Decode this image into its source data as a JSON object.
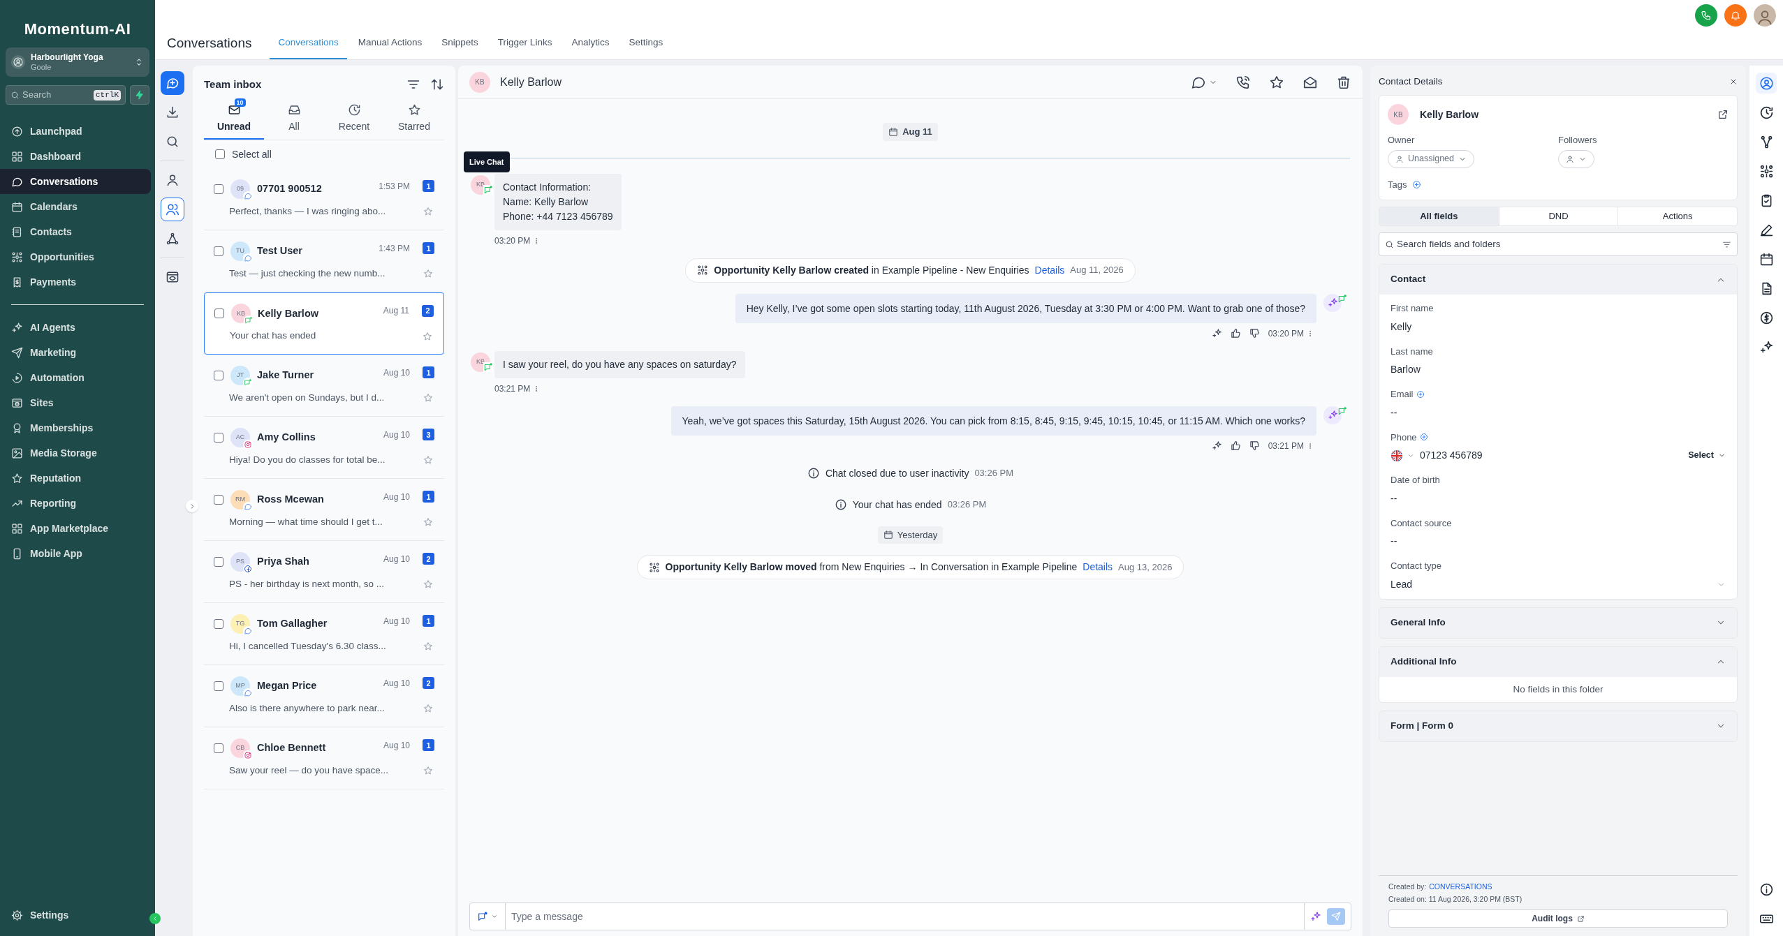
{
  "sidebar": {
    "brand": "Momentum-AI",
    "account": {
      "name": "Harbourlight Yoga",
      "location": "Goole"
    },
    "search": {
      "placeholder": "Search",
      "shortcut": "ctrlK"
    },
    "primary_items": [
      {
        "label": "Launchpad",
        "selected": false
      },
      {
        "label": "Dashboard",
        "selected": false
      },
      {
        "label": "Conversations",
        "selected": true
      },
      {
        "label": "Calendars",
        "selected": false
      },
      {
        "label": "Contacts",
        "selected": false
      },
      {
        "label": "Opportunities",
        "selected": false
      },
      {
        "label": "Payments",
        "selected": false
      }
    ],
    "secondary_items": [
      {
        "label": "AI Agents",
        "selected": false
      },
      {
        "label": "Marketing",
        "selected": false
      },
      {
        "label": "Automation",
        "selected": false
      },
      {
        "label": "Sites",
        "selected": false
      },
      {
        "label": "Memberships",
        "selected": false
      },
      {
        "label": "Media Storage",
        "selected": false
      },
      {
        "label": "Reputation",
        "selected": false
      },
      {
        "label": "Reporting",
        "selected": false
      },
      {
        "label": "App Marketplace",
        "selected": false
      },
      {
        "label": "Mobile App",
        "selected": false
      }
    ],
    "settings": "Settings"
  },
  "header": {
    "title": "Conversations",
    "tabs": [
      {
        "label": "Conversations",
        "selected": true
      },
      {
        "label": "Manual Actions",
        "selected": false
      },
      {
        "label": "Snippets",
        "selected": false
      },
      {
        "label": "Trigger Links",
        "selected": false
      },
      {
        "label": "Analytics",
        "selected": false
      },
      {
        "label": "Settings",
        "selected": false
      }
    ]
  },
  "rail": [
    {
      "kind": "compose",
      "selected": false
    },
    {
      "kind": "download",
      "selected": false
    },
    {
      "kind": "search",
      "selected": false
    },
    {
      "kind": "person",
      "selected": false
    },
    {
      "kind": "team",
      "selected": true
    },
    {
      "kind": "network",
      "selected": false
    },
    {
      "kind": "preview",
      "selected": false
    }
  ],
  "inbox": {
    "title": "Team inbox",
    "filters": [
      {
        "label": "Unread",
        "badge": "10",
        "selected": true
      },
      {
        "label": "All",
        "selected": false
      },
      {
        "label": "Recent",
        "selected": false
      },
      {
        "label": "Starred",
        "selected": false
      }
    ],
    "select_all": {
      "label": "Select all",
      "checked": false
    },
    "conversations": [
      {
        "initials": "09",
        "color": "#dfe3f7",
        "kind": "chat",
        "name": "07701 900512",
        "time": "1:53 PM",
        "count": "1",
        "preview": "Perfect, thanks — I was ringing abo...",
        "checked": false,
        "selected": false
      },
      {
        "initials": "TU",
        "color": "#cde8fa",
        "kind": "chat",
        "name": "Test User",
        "time": "1:43 PM",
        "count": "1",
        "preview": "Test — just checking the new numb...",
        "checked": false,
        "selected": false
      },
      {
        "initials": "KB",
        "color": "#fbd5dd",
        "kind": "livechat",
        "name": "Kelly Barlow",
        "time": "Aug 11",
        "count": "2",
        "preview": "Your chat has ended",
        "checked": false,
        "selected": true
      },
      {
        "initials": "JT",
        "color": "#cde8fa",
        "kind": "livechat",
        "name": "Jake Turner",
        "time": "Aug 10",
        "count": "1",
        "preview": "We aren't open on Sundays, but I d...",
        "checked": false,
        "selected": false
      },
      {
        "initials": "AC",
        "color": "#dfe3f7",
        "kind": "instagram",
        "name": "Amy Collins",
        "time": "Aug 10",
        "count": "3",
        "preview": "Hiya! Do you do classes for total be...",
        "checked": false,
        "selected": false
      },
      {
        "initials": "RM",
        "color": "#fddcb8",
        "kind": "chat",
        "name": "Ross Mcewan",
        "time": "Aug 10",
        "count": "1",
        "preview": "Morning — what time should I get t...",
        "checked": false,
        "selected": false
      },
      {
        "initials": "PS",
        "color": "#dfe3f7",
        "kind": "facebook",
        "name": "Priya Shah",
        "time": "Aug 10",
        "count": "2",
        "preview": "PS - her birthday is next month, so ...",
        "checked": false,
        "selected": false
      },
      {
        "initials": "TG",
        "color": "#fdf0b5",
        "kind": "chat",
        "name": "Tom Gallagher",
        "time": "Aug 10",
        "count": "1",
        "preview": "Hi, I cancelled Tuesday's 6.30 class...",
        "checked": false,
        "selected": false
      },
      {
        "initials": "MP",
        "color": "#cde8fa",
        "kind": "chat",
        "name": "Megan Price",
        "time": "Aug 10",
        "count": "2",
        "preview": "Also is there anywhere to park near...",
        "checked": false,
        "selected": false
      },
      {
        "initials": "CB",
        "color": "#fbd5dd",
        "kind": "instagram",
        "name": "Chloe Bennett",
        "time": "Aug 10",
        "count": "1",
        "preview": "Saw your reel — do you have space...",
        "checked": false,
        "selected": false
      }
    ]
  },
  "chat": {
    "contact": {
      "initials": "KB",
      "name": "Kelly Barlow"
    },
    "tooltip": "Live Chat",
    "events": [
      {
        "kind": "date",
        "text": "Aug 11",
        "divider": true
      },
      {
        "kind": "incoming",
        "initials": "KB",
        "text": "Contact Information:\nName: Kelly Barlow\nPhone: +44 7123 456789",
        "time": "03:20 PM"
      },
      {
        "kind": "opportunity",
        "text": "**Opportunity Kelly Barlow created** in Example Pipeline - New Enquiries",
        "link": "Details",
        "date": "Aug 11, 2026"
      },
      {
        "kind": "outgoing",
        "text": "Hey Kelly, I’ve got some open slots starting today, 11th August 2026, Tuesday at 3:30 PM or 4:00 PM. Want to grab one of those?",
        "time": "03:20 PM"
      },
      {
        "kind": "incoming",
        "initials": "KB",
        "text": "I saw your reel, do you have any spaces on saturday?",
        "time": "03:21 PM"
      },
      {
        "kind": "outgoing",
        "text": "Yeah, we’ve got spaces this Saturday, 15th August 2026. You can pick from 8:15, 8:45, 9:15, 9:45, 10:15, 10:45, or 11:15 AM. Which one works?",
        "time": "03:21 PM"
      },
      {
        "kind": "notice",
        "text": "Chat closed due to user inactivity",
        "time": "03:26 PM"
      },
      {
        "kind": "notice",
        "text": "Your chat has ended",
        "time": "03:26 PM"
      },
      {
        "kind": "date",
        "text": "Yesterday",
        "divider": false
      },
      {
        "kind": "opportunity",
        "text": "**Opportunity Kelly Barlow moved** from New Enquiries → In Conversation in Example Pipeline",
        "link": "Details",
        "date": "Aug 13, 2026"
      }
    ],
    "composer": {
      "placeholder": "Type a message"
    }
  },
  "contact_panel": {
    "title": "Contact Details",
    "contact": {
      "initials": "KB",
      "name": "Kelly Barlow"
    },
    "owner": {
      "label": "Owner",
      "value": "Unassigned"
    },
    "followers": {
      "label": "Followers"
    },
    "tags": "Tags",
    "tabs": [
      {
        "label": "All fields",
        "selected": true
      },
      {
        "label": "DND",
        "selected": false
      },
      {
        "label": "Actions",
        "selected": false
      }
    ],
    "search": {
      "placeholder": "Search fields and folders"
    },
    "sections": [
      {
        "title": "Contact",
        "expanded": true,
        "fields": [
          {
            "kind": "text",
            "label": "First name",
            "value": "Kelly",
            "addable": false
          },
          {
            "kind": "text",
            "label": "Last name",
            "value": "Barlow",
            "addable": false
          },
          {
            "kind": "text",
            "label": "Email",
            "value": "--",
            "addable": true
          },
          {
            "kind": "phone",
            "label": "Phone",
            "value": "07123 456789",
            "action": "Select",
            "addable": true
          },
          {
            "kind": "text",
            "label": "Date of birth",
            "value": "--",
            "addable": false
          },
          {
            "kind": "text",
            "label": "Contact source",
            "value": "--",
            "addable": false
          },
          {
            "kind": "dropdown",
            "label": "Contact type",
            "value": "Lead",
            "addable": false
          }
        ]
      },
      {
        "title": "General Info",
        "expanded": false
      },
      {
        "title": "Additional Info",
        "expanded": true,
        "empty": "No fields in this folder"
      },
      {
        "title": "Form | Form 0",
        "expanded": false
      }
    ],
    "footer": {
      "created_by_label": "Created by:",
      "created_by": "CONVERSATIONS",
      "created_on": "Created on: 11 Aug 2026, 3:20 PM (BST)",
      "audit": "Audit logs"
    }
  },
  "right_rail": [
    {
      "kind": "contact",
      "selected": true
    },
    {
      "kind": "activity",
      "selected": false
    },
    {
      "kind": "workflow",
      "selected": false
    },
    {
      "kind": "opportunity",
      "selected": false
    },
    {
      "kind": "tasks",
      "selected": false
    },
    {
      "kind": "notes",
      "selected": false
    },
    {
      "kind": "calendar",
      "selected": false
    },
    {
      "kind": "documents",
      "selected": false
    },
    {
      "kind": "payments",
      "selected": false
    },
    {
      "kind": "ai",
      "selected": false
    }
  ],
  "right_rail_bottom": [
    {
      "kind": "info",
      "selected": false
    },
    {
      "kind": "keyboard",
      "selected": false
    }
  ]
}
